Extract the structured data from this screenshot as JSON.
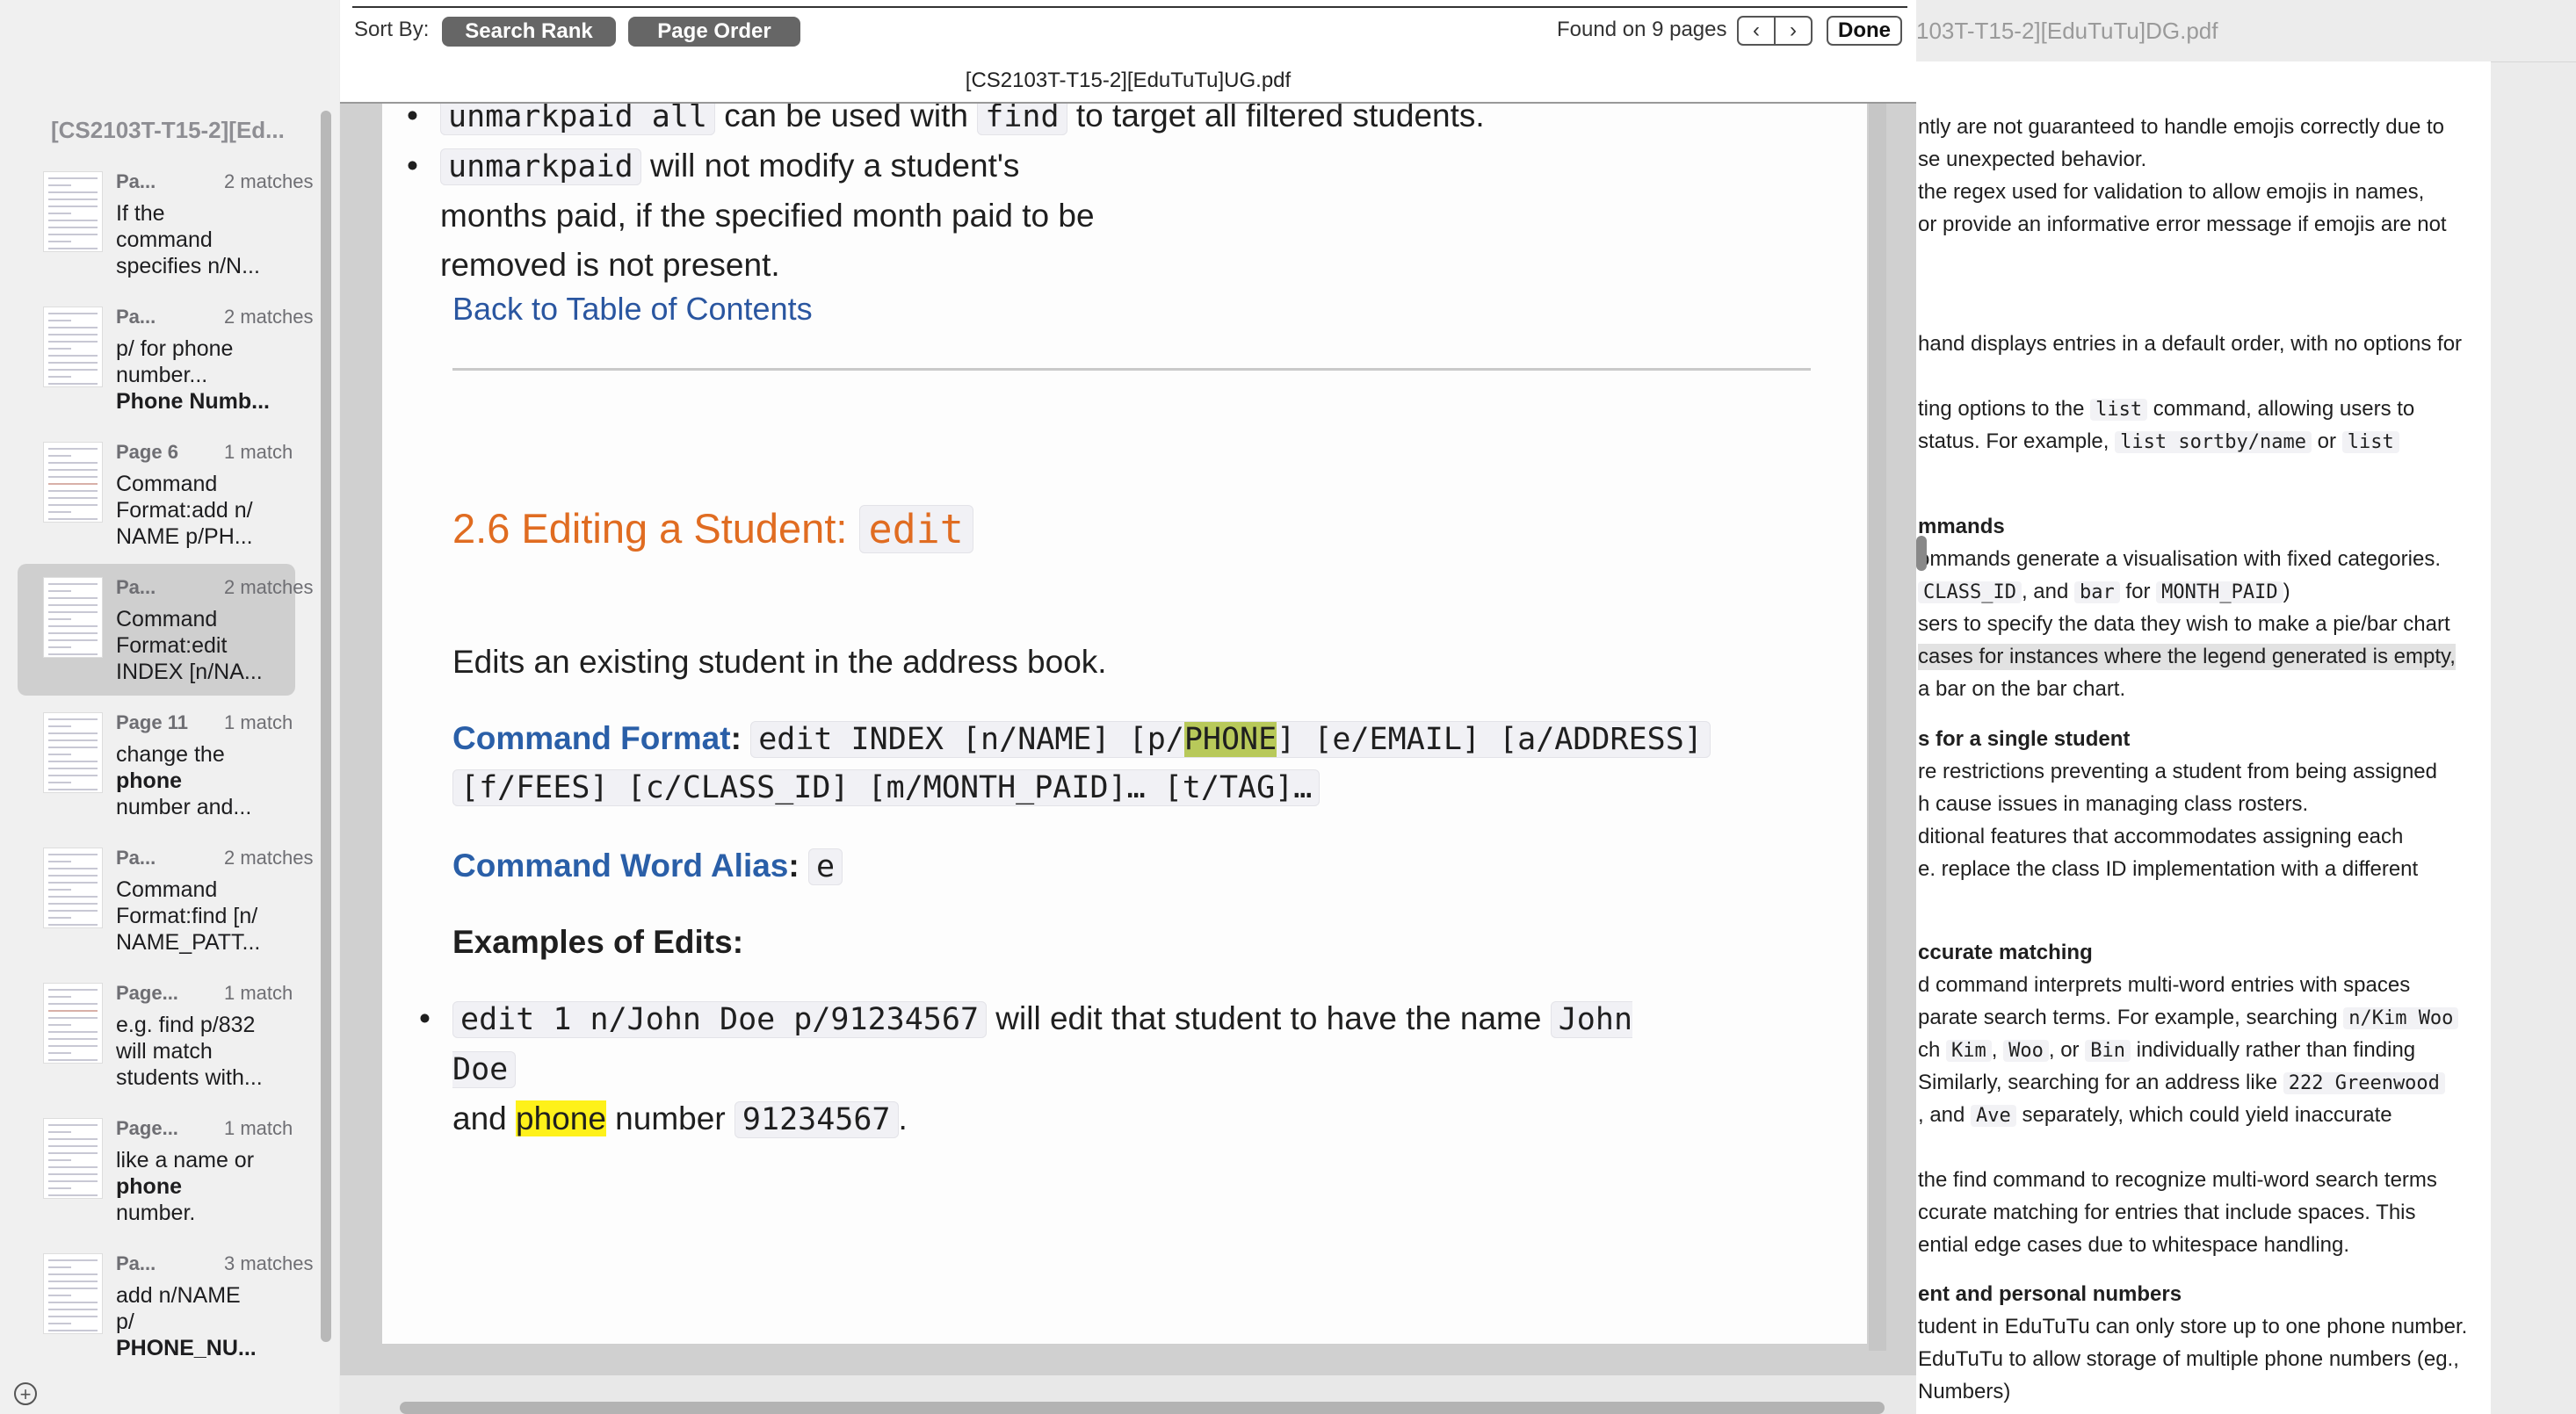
{
  "sidebar": {
    "document_title": "[CS2103T-T15-2][Ed...",
    "add_button": "+",
    "results": [
      {
        "page": "Pa...",
        "matches": "2 matches",
        "snippet": [
          "If the",
          "command",
          "specifies n/N..."
        ],
        "bold": []
      },
      {
        "page": "Pa...",
        "matches": "2 matches",
        "snippet": [
          "p/ for phone",
          "number...",
          "Phone Numb..."
        ],
        "bold": [
          "phone",
          "Phone"
        ]
      },
      {
        "page": "Page 6",
        "matches": "1 match",
        "snippet": [
          "Command",
          "Format:add n/",
          "NAME p/PH..."
        ],
        "bold": [
          "PH..."
        ]
      },
      {
        "page": "Pa...",
        "matches": "2 matches",
        "snippet": [
          "Command",
          "Format:edit",
          "INDEX [n/NA..."
        ],
        "bold": []
      },
      {
        "page": "Page 11",
        "matches": "1 match",
        "snippet": [
          "change the",
          "phone",
          "number and..."
        ],
        "bold": [
          "phone"
        ]
      },
      {
        "page": "Pa...",
        "matches": "2 matches",
        "snippet": [
          "Command",
          "Format:find [n/",
          "NAME_PATT..."
        ],
        "bold": []
      },
      {
        "page": "Page...",
        "matches": "1 match",
        "snippet": [
          "e.g. find p/832",
          "will match",
          "students with..."
        ],
        "bold": []
      },
      {
        "page": "Page...",
        "matches": "1 match",
        "snippet": [
          "like a name or",
          "phone",
          "number."
        ],
        "bold": [
          "phone"
        ]
      },
      {
        "page": "Pa...",
        "matches": "3 matches",
        "snippet": [
          "add n/NAME",
          "p/",
          "PHONE_NU..."
        ],
        "bold": [
          "PHONE"
        ]
      }
    ],
    "selected_index": 3
  },
  "findbar": {
    "sort_label": "Sort By:",
    "sort_search_rank": "Search Rank",
    "sort_page_order": "Page Order",
    "found_text": "Found on 9 pages",
    "prev_glyph": "‹",
    "next_glyph": "›",
    "done_label": "Done",
    "document_name": "[CS2103T-T15-2][EduTuTu]UG.pdf"
  },
  "doc": {
    "bullet1_code1": "unmarkpaid all",
    "bullet1_text1": " can be used with ",
    "bullet1_code2": "find",
    "bullet1_text2": " to target all filtered students.",
    "bullet2_code": "unmarkpaid",
    "bullet2_text": " will not modify a student's months paid, if the specified month paid to be removed is not present.",
    "back_link": "Back to Table of Contents",
    "section_heading": "2.6 Editing a Student: ",
    "section_heading_code": "edit",
    "section_desc": "Edits an existing student in the address book.",
    "cmd_format_label": "Command Format",
    "cmd_format_line1_a": "edit INDEX [n/NAME] [p/",
    "cmd_format_line1_hl": "PHONE",
    "cmd_format_line1_b": "] [e/EMAIL] [a/ADDRESS]",
    "cmd_format_line2": "[f/FEES] [c/CLASS_ID] [m/MONTH_PAID]… [t/TAG]…",
    "alias_label": "Command Word Alias",
    "alias_code": "e",
    "examples_heading": "Examples of Edits:",
    "example_code": "edit 1 n/John Doe p/91234567",
    "example_text1": " will edit that student to have the name ",
    "example_name": "John Doe",
    "example_text2_pre": "and ",
    "example_hl": "phone",
    "example_text2_post": " number ",
    "example_number": "91234567",
    "example_end": "."
  },
  "right_window": {
    "title": "103T-T15-2][EduTuTu]DG.pdf",
    "lines": [
      {
        "text": "ntly are not guaranteed to handle emojis correctly due to"
      },
      {
        "text": "se unexpected behavior."
      },
      {
        "text": "the regex used for validation to allow emojis in names,"
      },
      {
        "text": "or provide an informative error message if emojis are not"
      },
      {
        "text": "hand displays entries in a default order, with no options for"
      },
      {
        "text": "ting options to the ",
        "code": "list",
        "after": " command, allowing users to"
      },
      {
        "text": "status. For example, ",
        "code": "list sortby/name",
        "after": " or ",
        "code2": "list"
      },
      {
        "text": "mmands",
        "bold": true
      },
      {
        "text": "ommands generate a visualisation with fixed categories."
      },
      {
        "text": " ",
        "code": "CLASS_ID",
        "after": ", and ",
        "code2": "bar",
        "after2": " for ",
        "code3": "MONTH_PAID",
        "after3": ")"
      },
      {
        "text": "sers to specify the data they wish to make a pie/bar chart"
      },
      {
        "text": "cases for instances where the legend generated is empty,"
      },
      {
        "text": " a bar on the bar chart."
      },
      {
        "text": "s for a single student",
        "bold": true
      },
      {
        "text": "re restrictions preventing a student from being assigned"
      },
      {
        "text": "h cause issues in managing class rosters."
      },
      {
        "text": "ditional features that accommodates assigning each"
      },
      {
        "text": "e. replace the class ID implementation with a different"
      },
      {
        "text": "ccurate matching",
        "bold": true
      },
      {
        "text": "d command interprets multi-word entries with spaces"
      },
      {
        "text": "parate search terms. For example, searching ",
        "code": "n/Kim Woo"
      },
      {
        "text": "ch ",
        "code": "Kim",
        "after": ", ",
        "code2": "Woo",
        "after2": ", or ",
        "code3": "Bin",
        "after3": " individually rather than finding"
      },
      {
        "text": " Similarly, searching for an address like ",
        "code": "222 Greenwood"
      },
      {
        "text": " , and ",
        "code": "Ave",
        "after": " separately, which could yield inaccurate"
      },
      {
        "text": "the find command to recognize multi-word search terms"
      },
      {
        "text": "ccurate matching for entries that include spaces. This"
      },
      {
        "text": "ential edge cases due to whitespace handling."
      },
      {
        "text": "ent and personal numbers",
        "bold": true
      },
      {
        "text": "tudent in EduTuTu can only store up to one phone number."
      },
      {
        "text": "EduTuTu to allow storage of multiple phone numbers (eg.,"
      },
      {
        "text": "Numbers)"
      }
    ]
  }
}
